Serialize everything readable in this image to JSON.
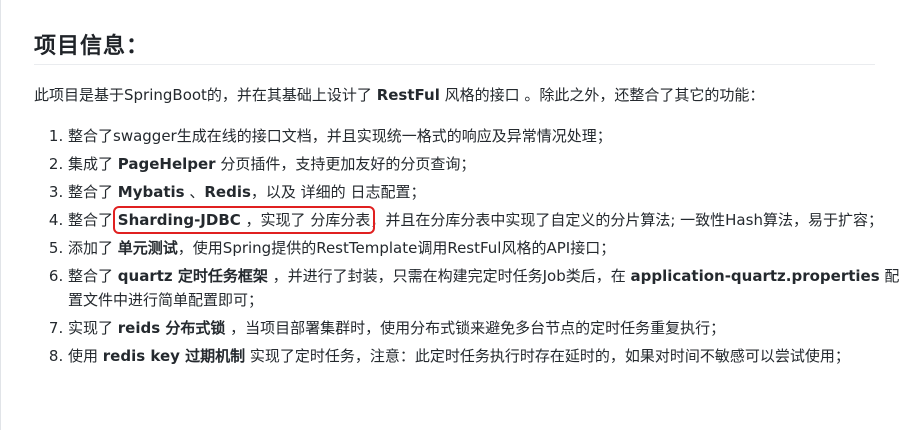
{
  "heading": "项目信息：",
  "intro": {
    "a": "此项目是基于SpringBoot的，并在其基础上设计了 ",
    "b": "RestFul",
    "c": " 风格的接口 。除此之外，还整合了其它的功能："
  },
  "items": [
    {
      "a": "整合了swagger生成在线的接口文档，并且实现统一格式的响应及异常情况处理；"
    },
    {
      "a": "集成了 ",
      "b": "PageHelper",
      "c": " 分页插件，支持更加友好的分页查询；"
    },
    {
      "a": "整合了 ",
      "b": "Mybatis",
      "c": " 、",
      "d": "Redis",
      "e": "，以及 详细的 日志配置；"
    },
    {
      "a": "整合了 ",
      "hl_b": "Sharding-JDBC",
      "hl_c": " ，实现了 分库分表",
      "c": "，并且在分库分表中实现了自定义的分片算法; 一致性Hash算法，易于扩容；"
    },
    {
      "a": "添加了 ",
      "b": "单元测试",
      "c": "，使用Spring提供的RestTemplate调用RestFul风格的API接口；"
    },
    {
      "a": "整合了 ",
      "b": "quartz 定时任务框架",
      "c": " ，并进行了封装，只需在构建完定时任务Job类后，在 ",
      "d": "application-quartz.properties",
      "e": " 配置文件中进行简单配置即可；"
    },
    {
      "a": "实现了 ",
      "b": "reids 分布式锁",
      "c": " ，当项目部署集群时，使用分布式锁来避免多台节点的定时任务重复执行；"
    },
    {
      "a": "使用 ",
      "b": "redis key 过期机制",
      "c": " 实现了定时任务，注意：此定时任务执行时存在延时的，如果对时间不敏感可以尝试使用；"
    }
  ],
  "highlight_color": "#e02020"
}
